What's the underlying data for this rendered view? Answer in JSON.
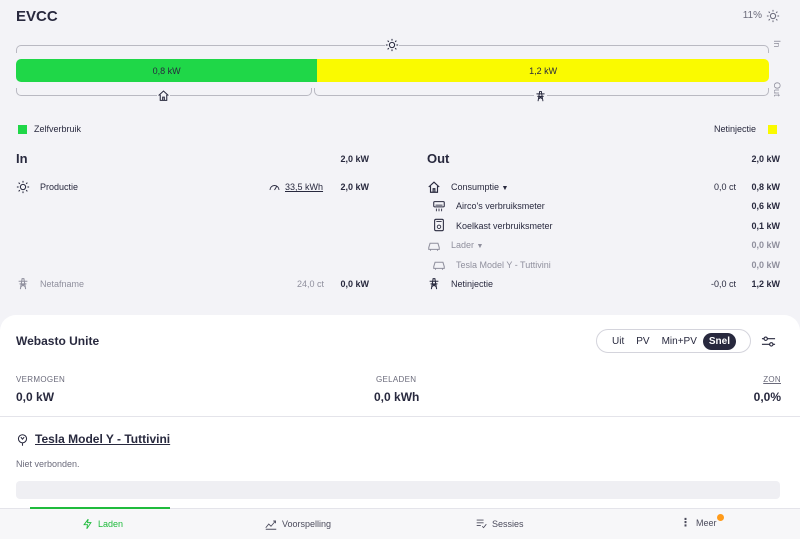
{
  "app": {
    "title": "EVCC"
  },
  "header": {
    "soc": "11%"
  },
  "energy_bar": {
    "segments": [
      {
        "label": "0,8 kW",
        "color": "#1fd748",
        "value_kw": 0.8
      },
      {
        "label": "1,2 kW",
        "color": "#fafa00",
        "value_kw": 1.2
      }
    ],
    "side_in": "In",
    "side_out": "Out"
  },
  "legend": {
    "self": {
      "label": "Zelfverbruik",
      "color": "#1fd748"
    },
    "export": {
      "label": "Netinjectie",
      "color": "#fafa00"
    }
  },
  "in_panel": {
    "title": "In",
    "total": "2,0 kW",
    "production": {
      "label": "Productie",
      "energy": "33,5 kWh",
      "power": "2,0 kW"
    },
    "grid": {
      "label": "Netafname",
      "price": "24,0 ct",
      "power": "0,0 kW"
    }
  },
  "out_panel": {
    "title": "Out",
    "total": "2,0 kW",
    "consumption": {
      "label": "Consumptie",
      "price": "0,0 ct",
      "power": "0,8 kW"
    },
    "airco": {
      "label": "Airco's verbruiksmeter",
      "power": "0,6 kW"
    },
    "fridge": {
      "label": "Koelkast verbruiksmeter",
      "power": "0,1 kW"
    },
    "charger": {
      "label": "Lader",
      "power": "0,0 kW"
    },
    "vehicle": {
      "label": "Tesla Model Y - Tuttivini",
      "power": "0,0 kW"
    },
    "export": {
      "label": "Netinjectie",
      "price": "-0,0 ct",
      "power": "1,2 kW"
    }
  },
  "loadpoint": {
    "title": "Webasto Unite",
    "modes": [
      "Uit",
      "PV",
      "Min+PV",
      "Snel"
    ],
    "active_mode": "Snel",
    "power_label": "VERMOGEN",
    "power_value": "0,0 kW",
    "charged_label": "GELADEN",
    "charged_value": "0,0 kWh",
    "zone_label": "ZON",
    "zone_value": "0,0%",
    "vehicle_name": "Tesla Model Y - Tuttivini",
    "vehicle_status": "Niet verbonden."
  },
  "nav": {
    "items": [
      "Laden",
      "Voorspelling",
      "Sessies",
      "Meer"
    ],
    "active_color": "#1fbb3c",
    "badge_color": "#ff9b1a"
  }
}
